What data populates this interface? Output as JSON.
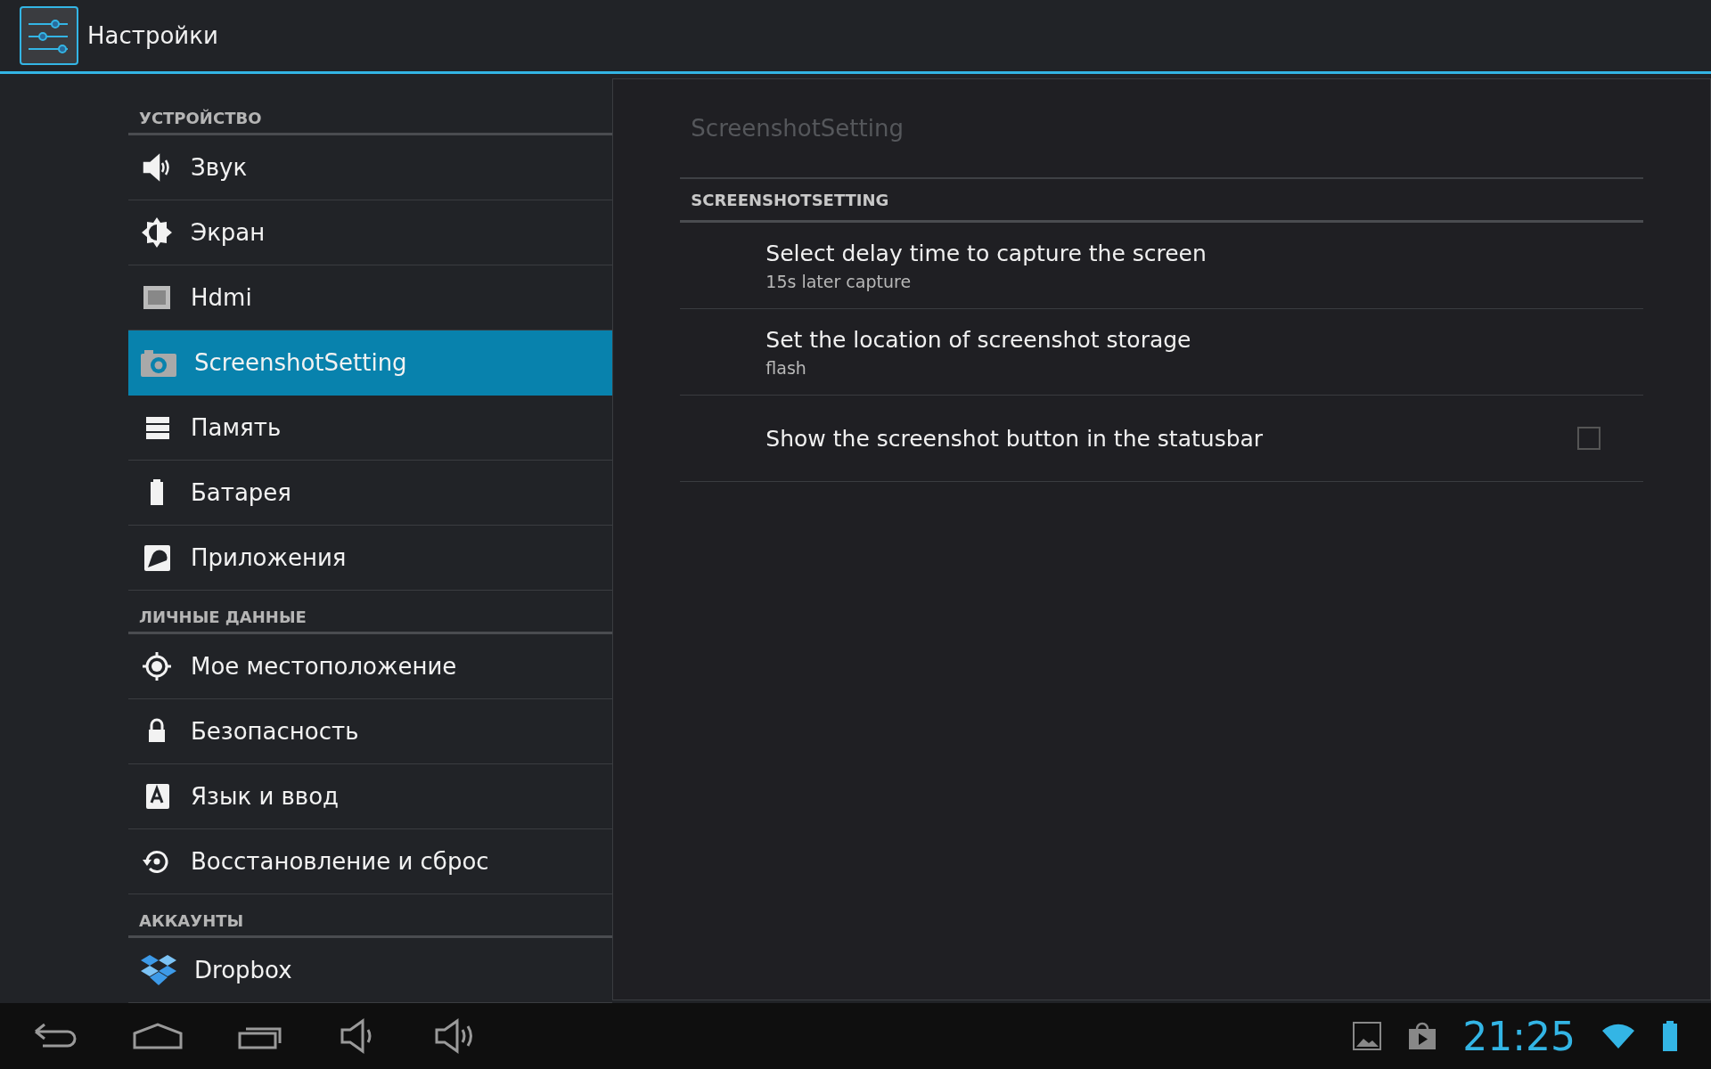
{
  "app_bar": {
    "title": "Настройки"
  },
  "sidebar": {
    "sections": [
      {
        "header": "УСТРОЙСТВО",
        "items": [
          {
            "kind": "sound",
            "label": "Звук",
            "selected": false
          },
          {
            "kind": "display",
            "label": "Экран",
            "selected": false
          },
          {
            "kind": "hdmi",
            "label": "Hdmi",
            "selected": false
          },
          {
            "kind": "camera",
            "label": "ScreenshotSetting",
            "selected": true
          },
          {
            "kind": "storage",
            "label": "Память",
            "selected": false
          },
          {
            "kind": "battery",
            "label": "Батарея",
            "selected": false
          },
          {
            "kind": "apps",
            "label": "Приложения",
            "selected": false
          }
        ]
      },
      {
        "header": "ЛИЧНЫЕ ДАННЫЕ",
        "items": [
          {
            "kind": "location",
            "label": "Мое местоположение",
            "selected": false
          },
          {
            "kind": "lock",
            "label": "Безопасность",
            "selected": false
          },
          {
            "kind": "language",
            "label": "Язык и ввод",
            "selected": false
          },
          {
            "kind": "restore",
            "label": "Восстановление и сброс",
            "selected": false
          }
        ]
      },
      {
        "header": "АККАУНТЫ",
        "items": [
          {
            "kind": "dropbox",
            "label": "Dropbox",
            "selected": false
          }
        ]
      }
    ]
  },
  "detail": {
    "title": "ScreenshotSetting",
    "category": "SCREENSHOTSETTING",
    "preferences": [
      {
        "kind": "text",
        "title": "Select delay time to capture the screen",
        "summary": "15s later capture"
      },
      {
        "kind": "text",
        "title": "Set the location of screenshot storage",
        "summary": "flash"
      },
      {
        "kind": "checkbox",
        "title": "Show the screenshot button in the statusbar",
        "checked": false
      }
    ]
  },
  "nav_bar": {
    "clock": "21:25"
  }
}
